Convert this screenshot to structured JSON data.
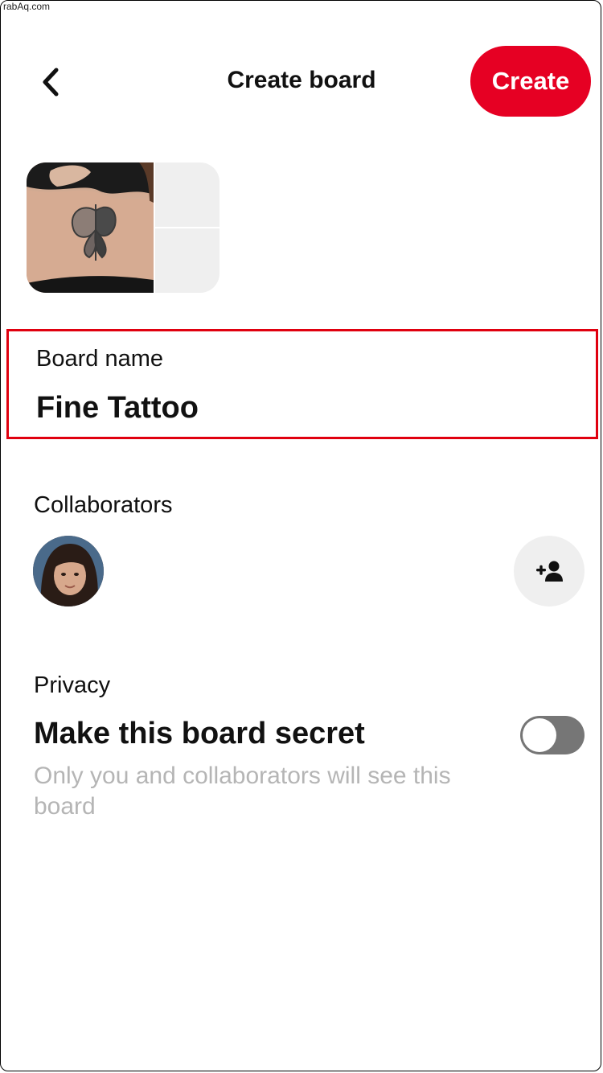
{
  "watermark": "rabAq.com",
  "header": {
    "title": "Create board",
    "create_label": "Create",
    "back_icon": "chevron-left-icon"
  },
  "board_name": {
    "label": "Board name",
    "value": "Fine Tattoo"
  },
  "collaborators": {
    "label": "Collaborators",
    "add_icon": "add-person-icon"
  },
  "privacy": {
    "label": "Privacy",
    "title": "Make this board secret",
    "description": "Only you and collaborators will see this board",
    "secret_enabled": false
  },
  "colors": {
    "accent": "#e60023",
    "highlight": "#e0000f",
    "muted_text": "#b5b5b5",
    "toggle_off": "#767676"
  }
}
